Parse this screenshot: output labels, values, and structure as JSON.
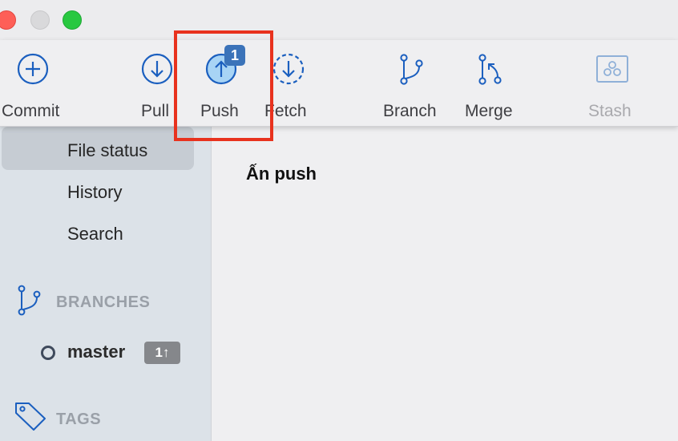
{
  "window": {
    "controls": [
      "close",
      "minimize",
      "maximize"
    ]
  },
  "toolbar": {
    "commit_label": "Commit",
    "pull_label": "Pull",
    "push_label": "Push",
    "push_badge": "1",
    "fetch_label": "Fetch",
    "branch_label": "Branch",
    "merge_label": "Merge",
    "stash_label": "Stash"
  },
  "sidebar": {
    "items": [
      {
        "label": "File status",
        "selected": true
      },
      {
        "label": "History"
      },
      {
        "label": "Search"
      }
    ],
    "branches_title": "BRANCHES",
    "branch": {
      "name": "master",
      "badge": "1↑"
    },
    "tags_title": "TAGS"
  },
  "content": {
    "caption": "Ấn push"
  },
  "colors": {
    "accent_blue": "#1b5fbf",
    "highlight_red": "#e8321e",
    "badge_blue": "#3b73b9"
  }
}
